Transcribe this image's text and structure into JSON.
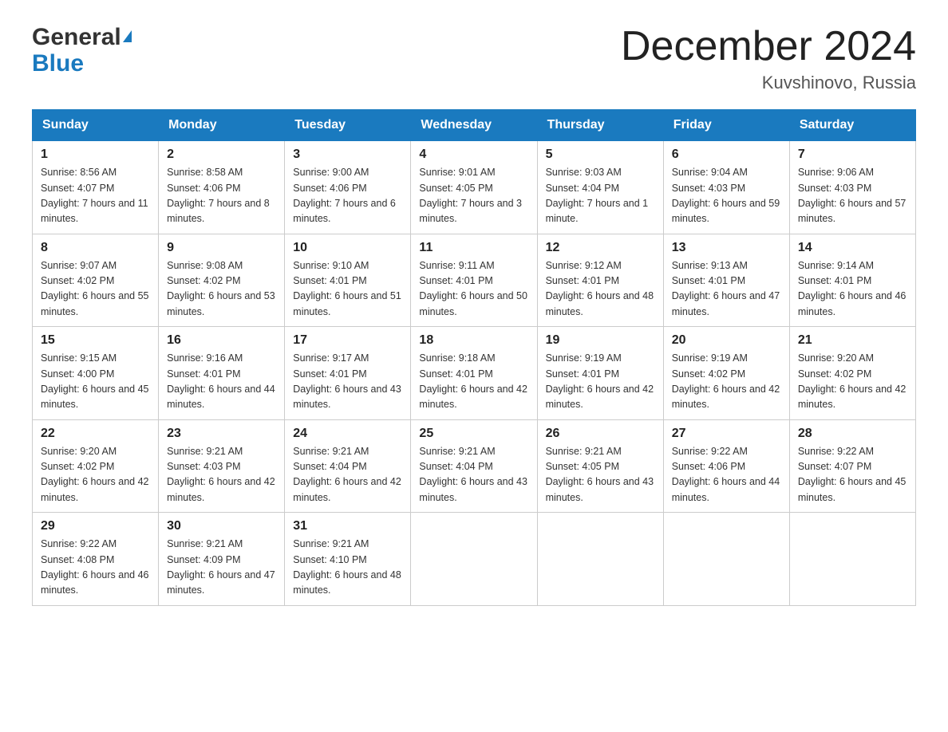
{
  "header": {
    "logo_line1": "General",
    "logo_line2": "Blue",
    "month_title": "December 2024",
    "location": "Kuvshinovo, Russia"
  },
  "days_of_week": [
    "Sunday",
    "Monday",
    "Tuesday",
    "Wednesday",
    "Thursday",
    "Friday",
    "Saturday"
  ],
  "weeks": [
    [
      {
        "day": "1",
        "sunrise": "8:56 AM",
        "sunset": "4:07 PM",
        "daylight": "7 hours and 11 minutes."
      },
      {
        "day": "2",
        "sunrise": "8:58 AM",
        "sunset": "4:06 PM",
        "daylight": "7 hours and 8 minutes."
      },
      {
        "day": "3",
        "sunrise": "9:00 AM",
        "sunset": "4:06 PM",
        "daylight": "7 hours and 6 minutes."
      },
      {
        "day": "4",
        "sunrise": "9:01 AM",
        "sunset": "4:05 PM",
        "daylight": "7 hours and 3 minutes."
      },
      {
        "day": "5",
        "sunrise": "9:03 AM",
        "sunset": "4:04 PM",
        "daylight": "7 hours and 1 minute."
      },
      {
        "day": "6",
        "sunrise": "9:04 AM",
        "sunset": "4:03 PM",
        "daylight": "6 hours and 59 minutes."
      },
      {
        "day": "7",
        "sunrise": "9:06 AM",
        "sunset": "4:03 PM",
        "daylight": "6 hours and 57 minutes."
      }
    ],
    [
      {
        "day": "8",
        "sunrise": "9:07 AM",
        "sunset": "4:02 PM",
        "daylight": "6 hours and 55 minutes."
      },
      {
        "day": "9",
        "sunrise": "9:08 AM",
        "sunset": "4:02 PM",
        "daylight": "6 hours and 53 minutes."
      },
      {
        "day": "10",
        "sunrise": "9:10 AM",
        "sunset": "4:01 PM",
        "daylight": "6 hours and 51 minutes."
      },
      {
        "day": "11",
        "sunrise": "9:11 AM",
        "sunset": "4:01 PM",
        "daylight": "6 hours and 50 minutes."
      },
      {
        "day": "12",
        "sunrise": "9:12 AM",
        "sunset": "4:01 PM",
        "daylight": "6 hours and 48 minutes."
      },
      {
        "day": "13",
        "sunrise": "9:13 AM",
        "sunset": "4:01 PM",
        "daylight": "6 hours and 47 minutes."
      },
      {
        "day": "14",
        "sunrise": "9:14 AM",
        "sunset": "4:01 PM",
        "daylight": "6 hours and 46 minutes."
      }
    ],
    [
      {
        "day": "15",
        "sunrise": "9:15 AM",
        "sunset": "4:00 PM",
        "daylight": "6 hours and 45 minutes."
      },
      {
        "day": "16",
        "sunrise": "9:16 AM",
        "sunset": "4:01 PM",
        "daylight": "6 hours and 44 minutes."
      },
      {
        "day": "17",
        "sunrise": "9:17 AM",
        "sunset": "4:01 PM",
        "daylight": "6 hours and 43 minutes."
      },
      {
        "day": "18",
        "sunrise": "9:18 AM",
        "sunset": "4:01 PM",
        "daylight": "6 hours and 42 minutes."
      },
      {
        "day": "19",
        "sunrise": "9:19 AM",
        "sunset": "4:01 PM",
        "daylight": "6 hours and 42 minutes."
      },
      {
        "day": "20",
        "sunrise": "9:19 AM",
        "sunset": "4:02 PM",
        "daylight": "6 hours and 42 minutes."
      },
      {
        "day": "21",
        "sunrise": "9:20 AM",
        "sunset": "4:02 PM",
        "daylight": "6 hours and 42 minutes."
      }
    ],
    [
      {
        "day": "22",
        "sunrise": "9:20 AM",
        "sunset": "4:02 PM",
        "daylight": "6 hours and 42 minutes."
      },
      {
        "day": "23",
        "sunrise": "9:21 AM",
        "sunset": "4:03 PM",
        "daylight": "6 hours and 42 minutes."
      },
      {
        "day": "24",
        "sunrise": "9:21 AM",
        "sunset": "4:04 PM",
        "daylight": "6 hours and 42 minutes."
      },
      {
        "day": "25",
        "sunrise": "9:21 AM",
        "sunset": "4:04 PM",
        "daylight": "6 hours and 43 minutes."
      },
      {
        "day": "26",
        "sunrise": "9:21 AM",
        "sunset": "4:05 PM",
        "daylight": "6 hours and 43 minutes."
      },
      {
        "day": "27",
        "sunrise": "9:22 AM",
        "sunset": "4:06 PM",
        "daylight": "6 hours and 44 minutes."
      },
      {
        "day": "28",
        "sunrise": "9:22 AM",
        "sunset": "4:07 PM",
        "daylight": "6 hours and 45 minutes."
      }
    ],
    [
      {
        "day": "29",
        "sunrise": "9:22 AM",
        "sunset": "4:08 PM",
        "daylight": "6 hours and 46 minutes."
      },
      {
        "day": "30",
        "sunrise": "9:21 AM",
        "sunset": "4:09 PM",
        "daylight": "6 hours and 47 minutes."
      },
      {
        "day": "31",
        "sunrise": "9:21 AM",
        "sunset": "4:10 PM",
        "daylight": "6 hours and 48 minutes."
      },
      null,
      null,
      null,
      null
    ]
  ],
  "labels": {
    "sunrise": "Sunrise:",
    "sunset": "Sunset:",
    "daylight": "Daylight:"
  }
}
